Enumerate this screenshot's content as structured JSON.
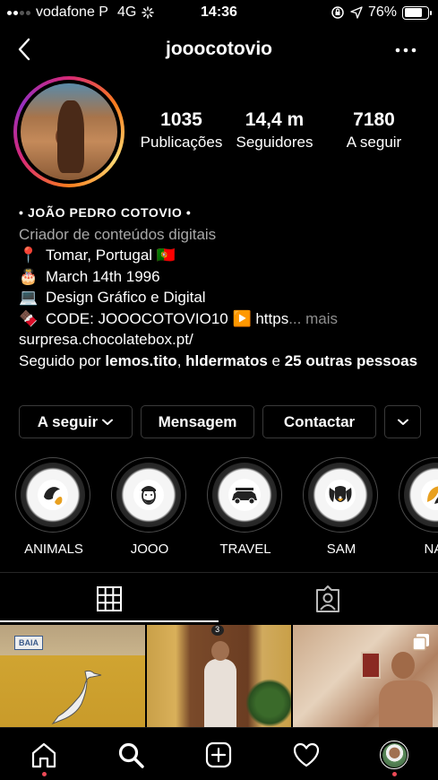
{
  "status_bar": {
    "carrier": "vodafone P",
    "network": "4G",
    "time": "14:36",
    "battery": "76%",
    "battery_level": 0.76
  },
  "header": {
    "username": "jooocotovio"
  },
  "stats": [
    {
      "value": "1035",
      "label": "Publicações"
    },
    {
      "value": "14,4 m",
      "label": "Seguidores"
    },
    {
      "value": "7180",
      "label": "A seguir"
    }
  ],
  "bio": {
    "name": "• JOÃO PEDRO COTOVIO •",
    "category": "Criador de conteúdos digitais",
    "lines": [
      {
        "emoji": "📍",
        "text": "Tomar, Portugal 🇵🇹"
      },
      {
        "emoji": "🎂",
        "text": "March 14th 1996"
      },
      {
        "emoji": "💻",
        "text": "Design Gráfico e Digital"
      },
      {
        "emoji": "🍫",
        "text": "CODE: JOOOCOTOVIO10 ▶️ https"
      }
    ],
    "more": "... mais",
    "link": "surpresa.chocolatebox.pt/",
    "followed_prefix": "Seguido por ",
    "followed_user1": "lemos.tito",
    "followed_sep": ", ",
    "followed_user2": "hldermatos",
    "followed_and": " e ",
    "followed_others": "25 outras pessoas"
  },
  "buttons": {
    "following": "A seguir",
    "message": "Mensagem",
    "contact": "Contactar"
  },
  "highlights": [
    {
      "label": "ANIMALS",
      "icon": "dolphin-icon"
    },
    {
      "label": "JOOO",
      "icon": "face-icon"
    },
    {
      "label": "TRAVEL",
      "icon": "car-icon"
    },
    {
      "label": "SAM",
      "icon": "dog-icon"
    },
    {
      "label": "NAT",
      "icon": "leaf-icon"
    }
  ],
  "tabs": {
    "grid": "grid-icon",
    "tagged": "tagged-icon"
  },
  "grid_posts": [
    {
      "sign": "BAIA"
    },
    {
      "number": "3"
    },
    {
      "multi": true
    }
  ],
  "colors": {
    "background": "#000000",
    "notification_dot": "#ed4956",
    "muted_text": "#8e8e8e"
  }
}
